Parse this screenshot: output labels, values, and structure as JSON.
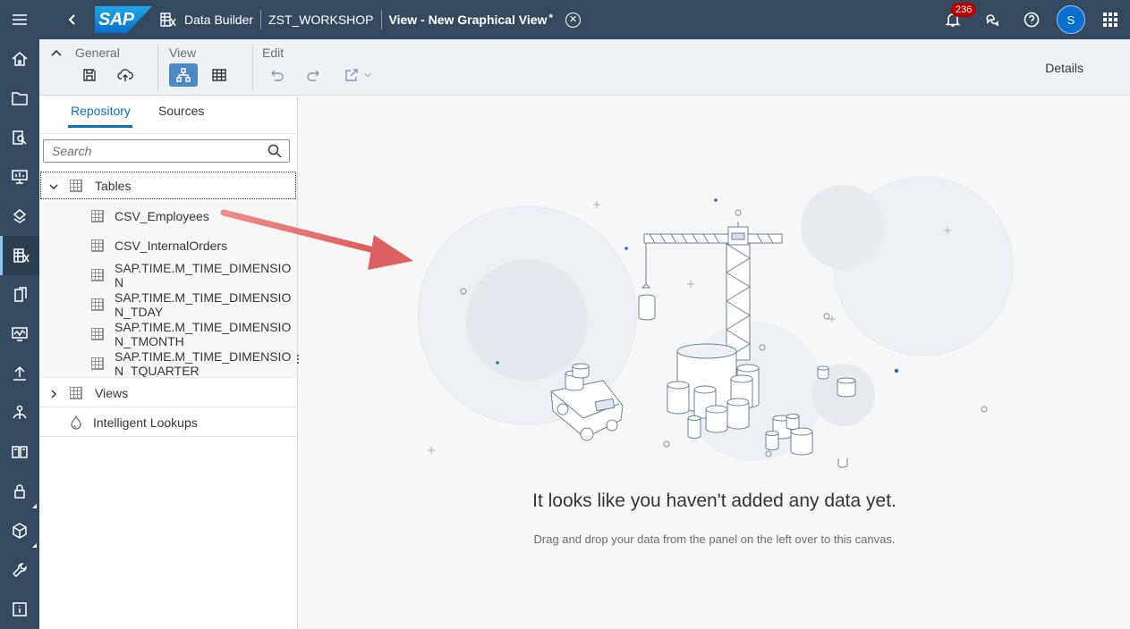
{
  "rail": {
    "items": [
      {
        "icon": "menu-icon",
        "name": "rail-menu"
      },
      {
        "icon": "home-icon",
        "name": "rail-home"
      },
      {
        "icon": "folder-icon",
        "name": "rail-repository"
      },
      {
        "icon": "data-search-icon",
        "name": "rail-catalog"
      },
      {
        "icon": "presentation-icon",
        "name": "rail-stories"
      },
      {
        "icon": "model-icon",
        "name": "rail-business-builder"
      },
      {
        "icon": "data-builder-icon",
        "name": "rail-data-builder"
      },
      {
        "icon": "access-icon",
        "name": "rail-data-access"
      },
      {
        "icon": "monitor-icon",
        "name": "rail-data-integration-monitor"
      },
      {
        "icon": "upload-icon",
        "name": "rail-transport"
      },
      {
        "icon": "sitemap-person-icon",
        "name": "rail-space-management"
      },
      {
        "icon": "book-icon",
        "name": "rail-catalog-glossary"
      },
      {
        "icon": "lock-icon",
        "name": "rail-security"
      },
      {
        "icon": "package-icon",
        "name": "rail-content-network"
      },
      {
        "icon": "wrench-icon",
        "name": "rail-configuration"
      },
      {
        "icon": "info-icon",
        "name": "rail-system-information"
      }
    ]
  },
  "shell": {
    "logo": "SAP",
    "app": "Data Builder",
    "space": "ZST_WORKSHOP",
    "view_title": "View - New Graphical View",
    "unsaved_marker": "*",
    "notification_count": "236",
    "avatar_initial": "S"
  },
  "toolbar": {
    "general": "General",
    "view": "View",
    "edit": "Edit",
    "details": "Details"
  },
  "panel": {
    "tabs": [
      "Repository",
      "Sources"
    ],
    "search_placeholder": "Search",
    "tables_label": "Tables",
    "tables": [
      "CSV_Employees",
      "CSV_InternalOrders",
      "SAP.TIME.M_TIME_DIMENSION",
      "SAP.TIME.M_TIME_DIMENSION_TDAY",
      "SAP.TIME.M_TIME_DIMENSION_TMONTH",
      "SAP.TIME.M_TIME_DIMENSION_TQUARTER"
    ],
    "table_lines": [
      [
        "CSV_Employees"
      ],
      [
        "CSV_InternalOrders"
      ],
      [
        "SAP.TIME.M_TIME_DIMENSIO",
        "N"
      ],
      [
        "SAP.TIME.M_TIME_DIMENSIO",
        "N_TDAY"
      ],
      [
        "SAP.TIME.M_TIME_DIMENSIO",
        "N_TMONTH"
      ],
      [
        "SAP.TIME.M_TIME_DIMENSIO",
        "N_TQUARTER"
      ]
    ],
    "views_label": "Views",
    "lookups_label": "Intelligent Lookups"
  },
  "canvas": {
    "empty_title": "It looks like you haven't added any data yet.",
    "empty_subtitle": "Drag and drop your data from the panel on the left over to this canvas."
  },
  "colors": {
    "shell": "#354a5f",
    "accent": "#0a6ed1",
    "badge": "#bb0000",
    "arrow": "#e06c6c"
  }
}
